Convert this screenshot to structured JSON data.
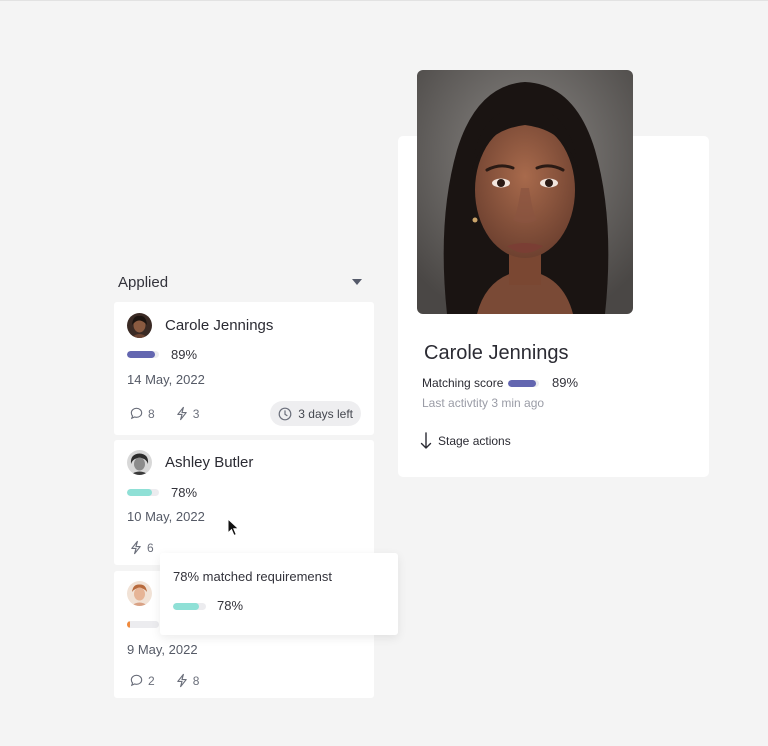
{
  "column": {
    "title": "Applied"
  },
  "candidates": [
    {
      "name": "Carole Jennings",
      "match_pct": "89%",
      "match_value": 0.89,
      "bar_color": "#6366b0",
      "date": "14 May, 2022",
      "comments": "8",
      "actions": "3",
      "deadline": "3 days left"
    },
    {
      "name": "Ashley Butler",
      "match_pct": "78%",
      "match_value": 0.78,
      "bar_color": "#8fe0d6",
      "date": "10 May, 2022",
      "actions": "6"
    },
    {
      "match_value": 0.08,
      "bar_color": "#f08a3c",
      "date": "9 May, 2022",
      "comments": "2",
      "actions": "8"
    }
  ],
  "tooltip": {
    "title": "78% matched requiremenst",
    "match_pct": "78%",
    "match_value": 0.78,
    "bar_color": "#8fe0d6"
  },
  "profile": {
    "name": "Carole Jennings",
    "score_label": "Matching score",
    "match_pct": "89%",
    "match_value": 0.89,
    "bar_color": "#6366b0",
    "activity": "Last activtity 3 min ago",
    "stage_actions": "Stage actions"
  }
}
